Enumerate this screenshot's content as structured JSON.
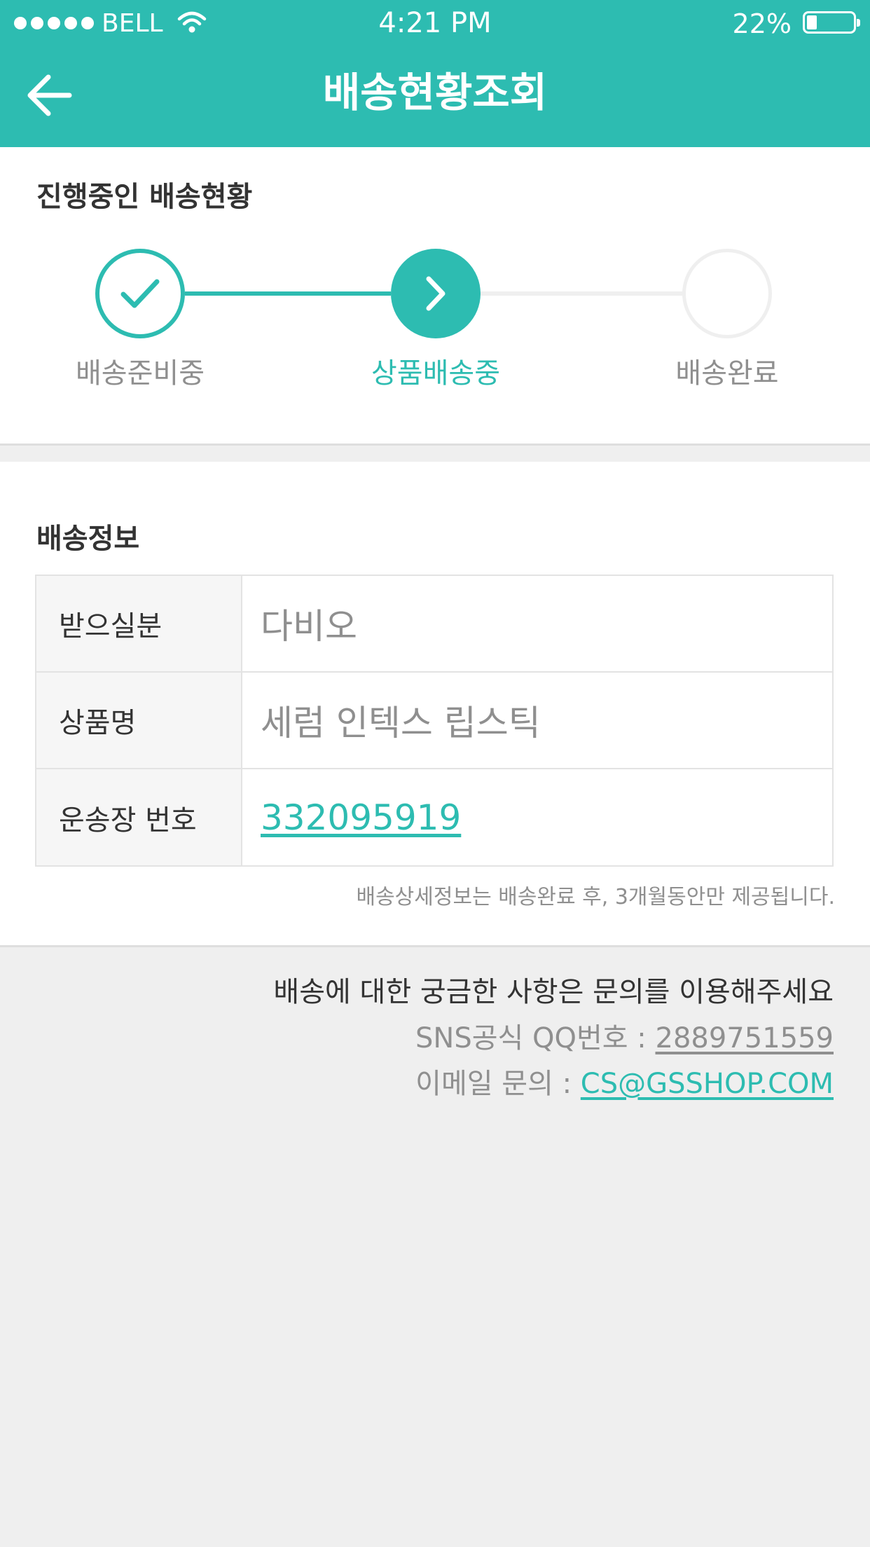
{
  "status_bar": {
    "carrier": "BELL",
    "time": "4:21 PM",
    "battery": "22%",
    "battery_level": 0.22
  },
  "header": {
    "title": "배송현황조회",
    "back_icon": "arrow-left-icon"
  },
  "progress": {
    "title": "진행중인 배송현황",
    "steps": [
      {
        "label": "배송준비중",
        "state": "done",
        "icon": "check-icon"
      },
      {
        "label": "상품배송중",
        "state": "current",
        "icon": "chevron-right-icon"
      },
      {
        "label": "배송완료",
        "state": "pending",
        "icon": ""
      }
    ]
  },
  "shipping_info": {
    "title": "배송정보",
    "rows": [
      {
        "label": "받으실분",
        "value": "다비오"
      },
      {
        "label": "상품명",
        "value": "세럼 인텍스 립스틱"
      },
      {
        "label": "운송장 번호",
        "value": "332095919"
      }
    ],
    "notice": "배송상세정보는 배송완료 후, 3개월동안만 제공됩니다."
  },
  "contact": {
    "message": "배송에 대한 궁금한 사항은 문의를 이용해주세요",
    "qq_label": "SNS공식 QQ번호 : ",
    "qq_number": "2889751559",
    "email_label": "이메일 문의 : ",
    "email": "CS@GSSHOP.COM"
  },
  "colors": {
    "accent": "#2dbcb1",
    "background": "#efefef",
    "muted_text": "#8f8f8f",
    "pending": "#efefef"
  }
}
